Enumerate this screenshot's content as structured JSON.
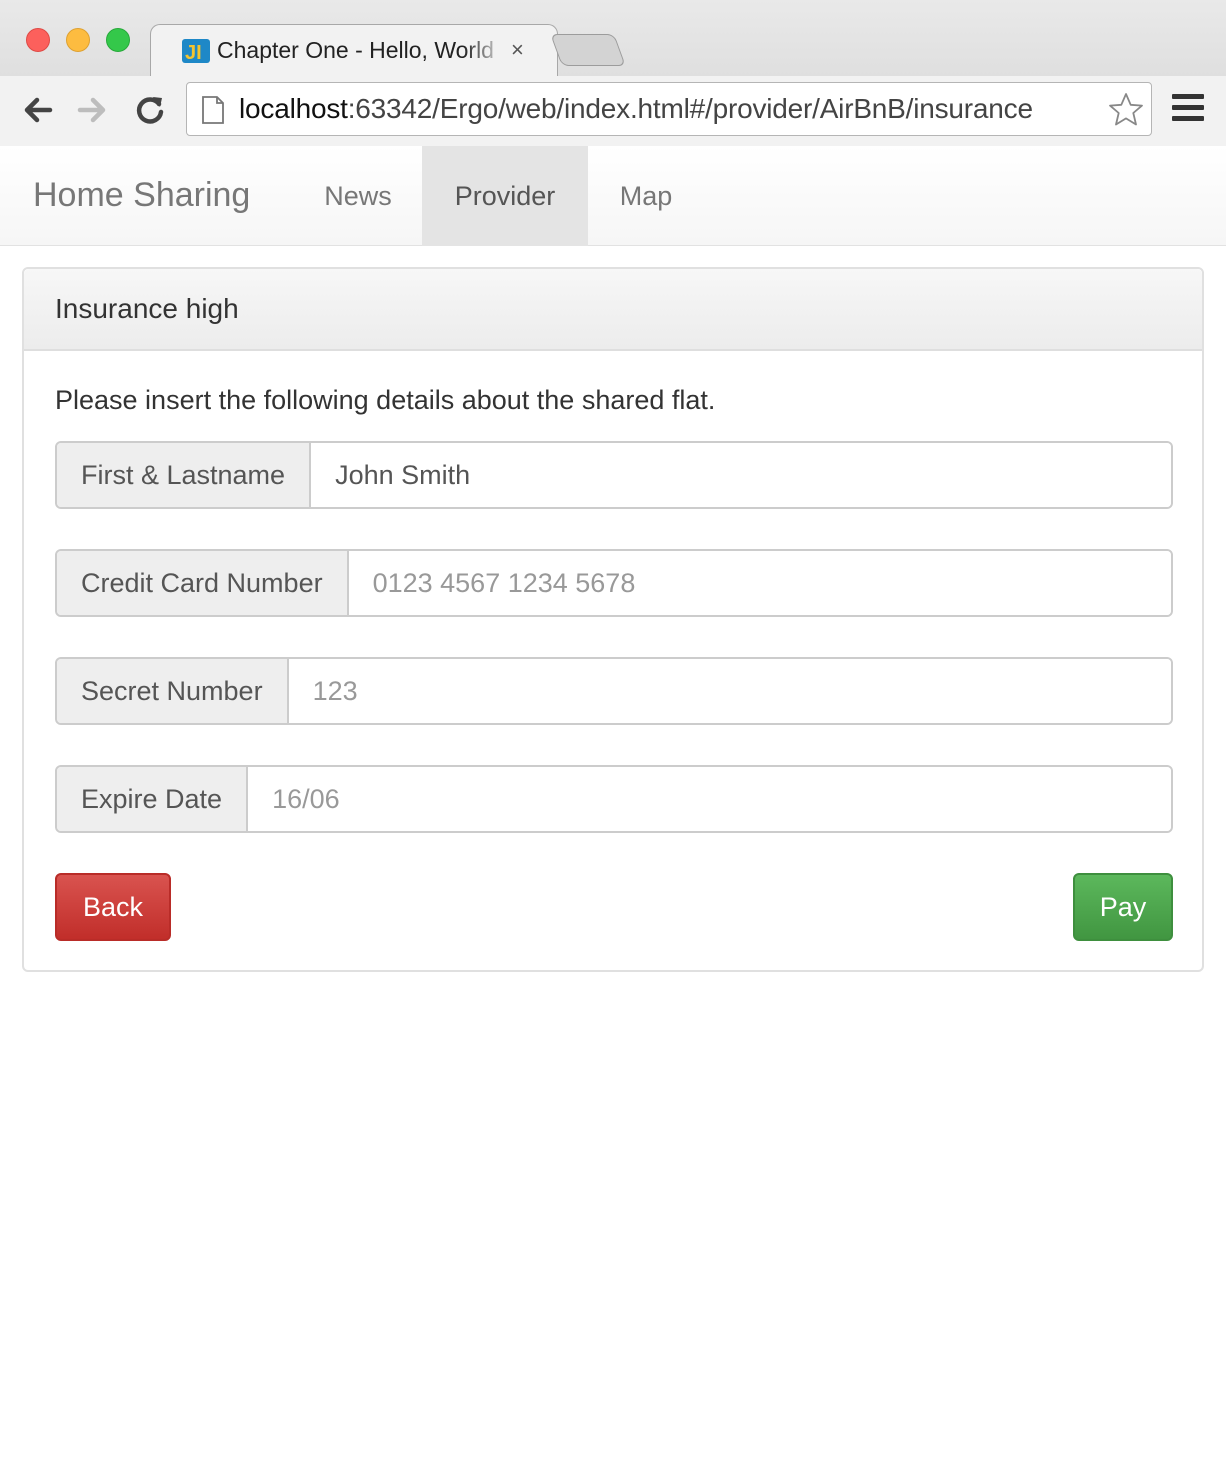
{
  "browser": {
    "tab_title": "Chapter One - Hello, World",
    "tab_close": "×",
    "url_host": "localhost",
    "url_rest": ":63342/Ergo/web/index.html#/provider/AirBnB/insurance"
  },
  "navbar": {
    "brand": "Home Sharing",
    "items": [
      {
        "label": "News",
        "active": false
      },
      {
        "label": "Provider",
        "active": true
      },
      {
        "label": "Map",
        "active": false
      }
    ]
  },
  "panel": {
    "title": "Insurance high",
    "intro": "Please insert the following details about the shared flat.",
    "fields": [
      {
        "label": "First & Lastname",
        "value": "John Smith",
        "placeholder": ""
      },
      {
        "label": "Credit Card Number",
        "value": "",
        "placeholder": "0123 4567 1234 5678"
      },
      {
        "label": "Secret Number",
        "value": "",
        "placeholder": "123"
      },
      {
        "label": "Expire Date",
        "value": "",
        "placeholder": "16/06"
      }
    ],
    "back_label": "Back",
    "pay_label": "Pay"
  },
  "colors": {
    "danger": "#d9534f",
    "success": "#5cb85c",
    "nav_active": "#e4e4e4"
  },
  "icons": {
    "tab_favicon": "webstorm-icon",
    "back": "arrow-left-icon",
    "forward": "arrow-right-icon",
    "reload": "reload-icon",
    "page": "page-icon",
    "bookmark": "star-icon",
    "menu": "hamburger-menu-icon"
  }
}
